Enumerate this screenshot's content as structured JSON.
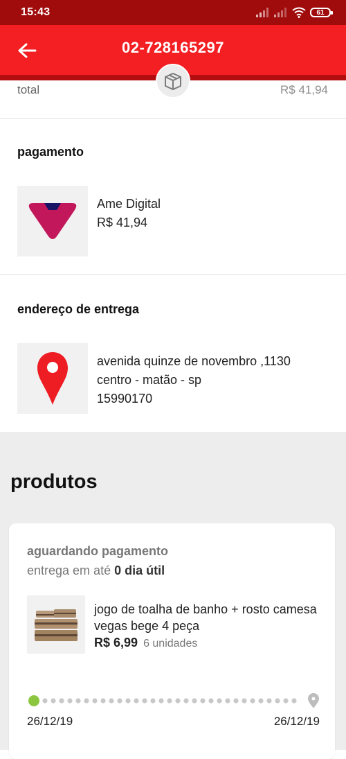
{
  "status_bar": {
    "time": "15:43",
    "battery": "61"
  },
  "header": {
    "title": "02-728165297"
  },
  "total": {
    "label": "total",
    "value": "R$ 41,94"
  },
  "payment": {
    "title": "pagamento",
    "method": "Ame Digital",
    "amount": "R$ 41,94",
    "icon": "ame-digital-logo"
  },
  "address": {
    "title": "endereço de entrega",
    "line1": "avenida quinze de novembro ,1130",
    "line2": "centro - matão - sp",
    "line3": "15990170",
    "icon": "location-pin-icon"
  },
  "products": {
    "title": "produtos",
    "card": {
      "status": "aguardando pagamento",
      "delivery_prefix": "entrega em até",
      "delivery_days": "0 dia útil",
      "item": {
        "name": "jogo de toalha de banho + rosto camesa vegas bege 4 peça",
        "price": "R$ 6,99",
        "quantity": "6 unidades"
      },
      "tracking": {
        "start_date": "26/12/19",
        "end_date": "26/12/19"
      }
    }
  },
  "colors": {
    "header": "#f41f22",
    "status_bar": "#a00b0c",
    "pin": "#ee1c23",
    "progress_start": "#8cc63f"
  }
}
